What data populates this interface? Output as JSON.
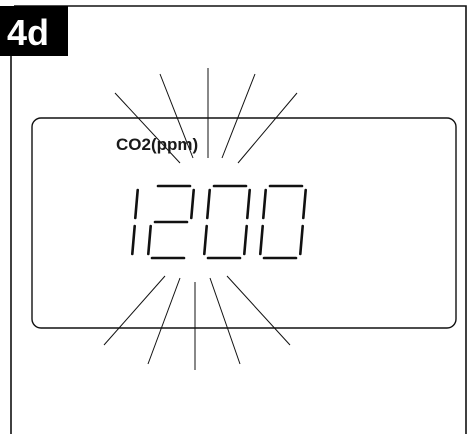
{
  "step_badge": {
    "label": "4d"
  },
  "display": {
    "unit_label": "CO2(ppm)",
    "reading": "1200",
    "blinking": true
  },
  "colors": {
    "badge_bg": "#000000",
    "badge_text": "#ffffff",
    "line": "#111111",
    "background": "#ffffff"
  }
}
